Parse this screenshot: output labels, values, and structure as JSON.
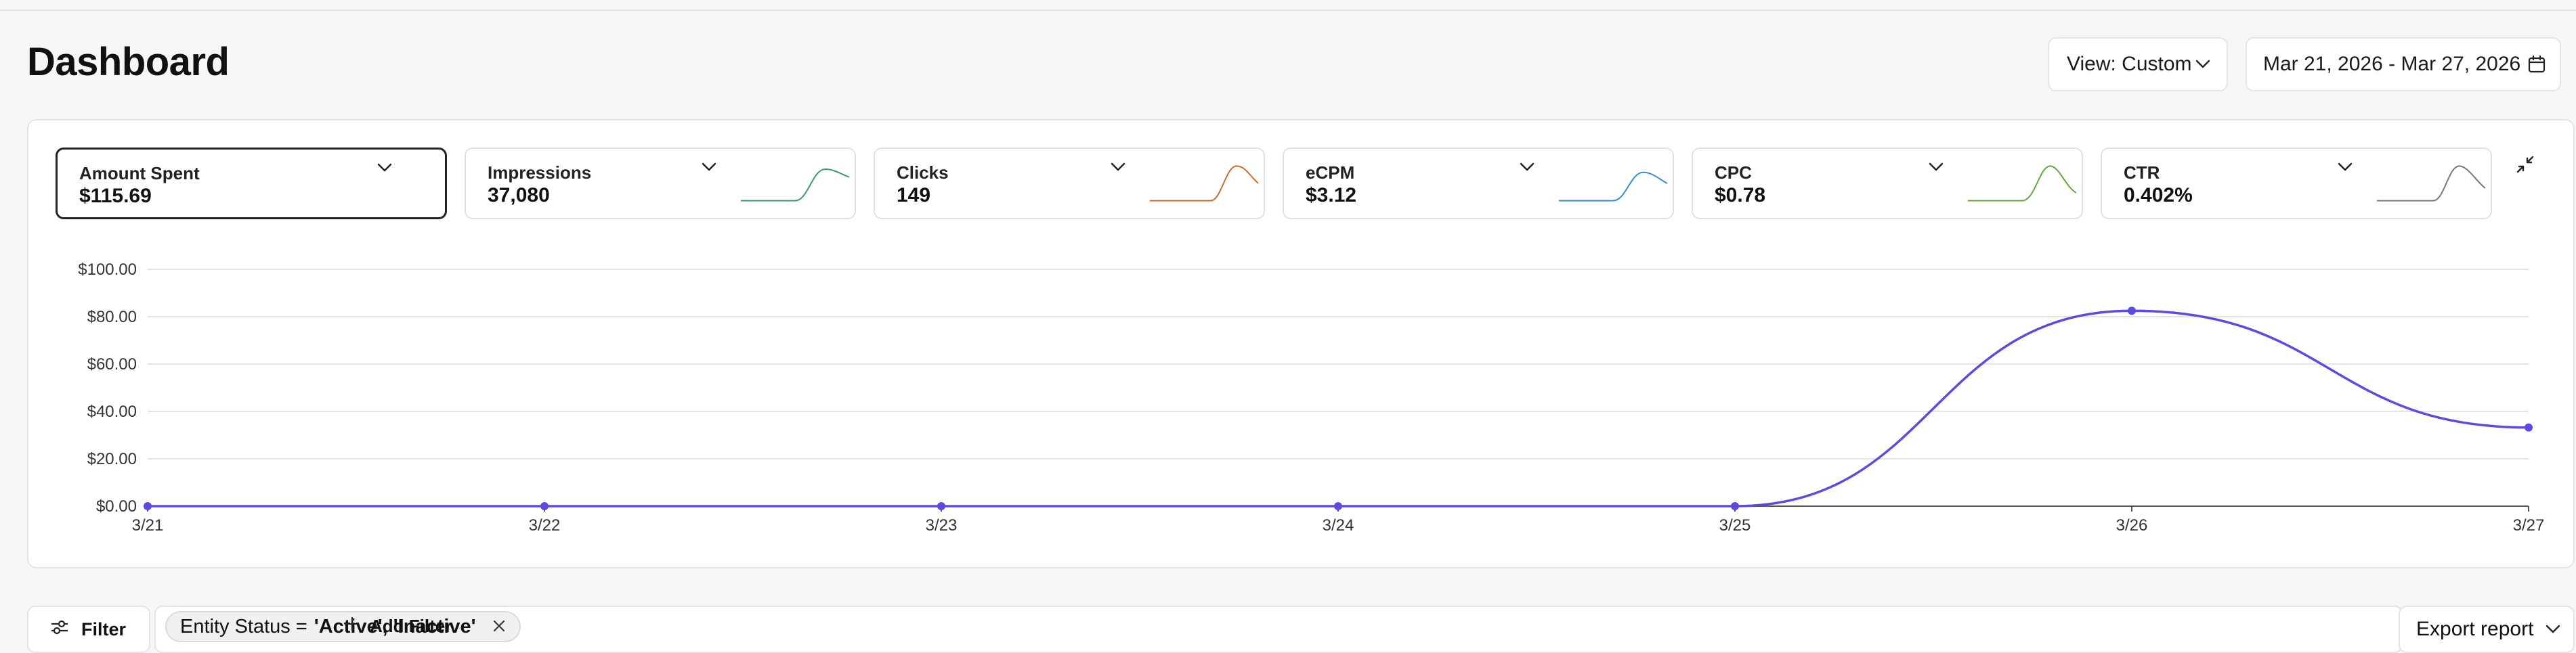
{
  "header": {
    "title": "Dashboard",
    "view_label": "View: Custom",
    "date_range": "Mar 21, 2026 - Mar 27, 2026"
  },
  "metrics": [
    {
      "label": "Amount Spent",
      "value": "$115.69",
      "active": true,
      "color": "#5b4be0"
    },
    {
      "label": "Impressions",
      "value": "37,080",
      "color": "#3a9a6a"
    },
    {
      "label": "Clicks",
      "value": "149",
      "color": "#d06a2a"
    },
    {
      "label": "eCPM",
      "value": "$3.12",
      "color": "#3a8ec8"
    },
    {
      "label": "CPC",
      "value": "$0.78",
      "color": "#5fa83a"
    },
    {
      "label": "CTR",
      "value": "0.402%",
      "color": "#777777"
    }
  ],
  "chart_data": {
    "type": "line",
    "x": [
      "3/21",
      "3/22",
      "3/23",
      "3/24",
      "3/25",
      "3/26",
      "3/27"
    ],
    "series": [
      {
        "values": [
          0,
          0,
          0,
          0,
          0,
          82.5,
          33.2
        ],
        "color": "#5b4be0"
      }
    ],
    "y_ticks": [
      "$0.00",
      "$20.00",
      "$40.00",
      "$60.00",
      "$80.00",
      "$100.00"
    ],
    "ylim": [
      0,
      100
    ],
    "grid": true,
    "smooth": true
  },
  "filters": {
    "filter_label": "Filter",
    "chip_key": "Entity Status =",
    "chip_value": "'Active', 'Inactive'",
    "add_filter_label": "Add Filter",
    "export_label": "Export report"
  }
}
